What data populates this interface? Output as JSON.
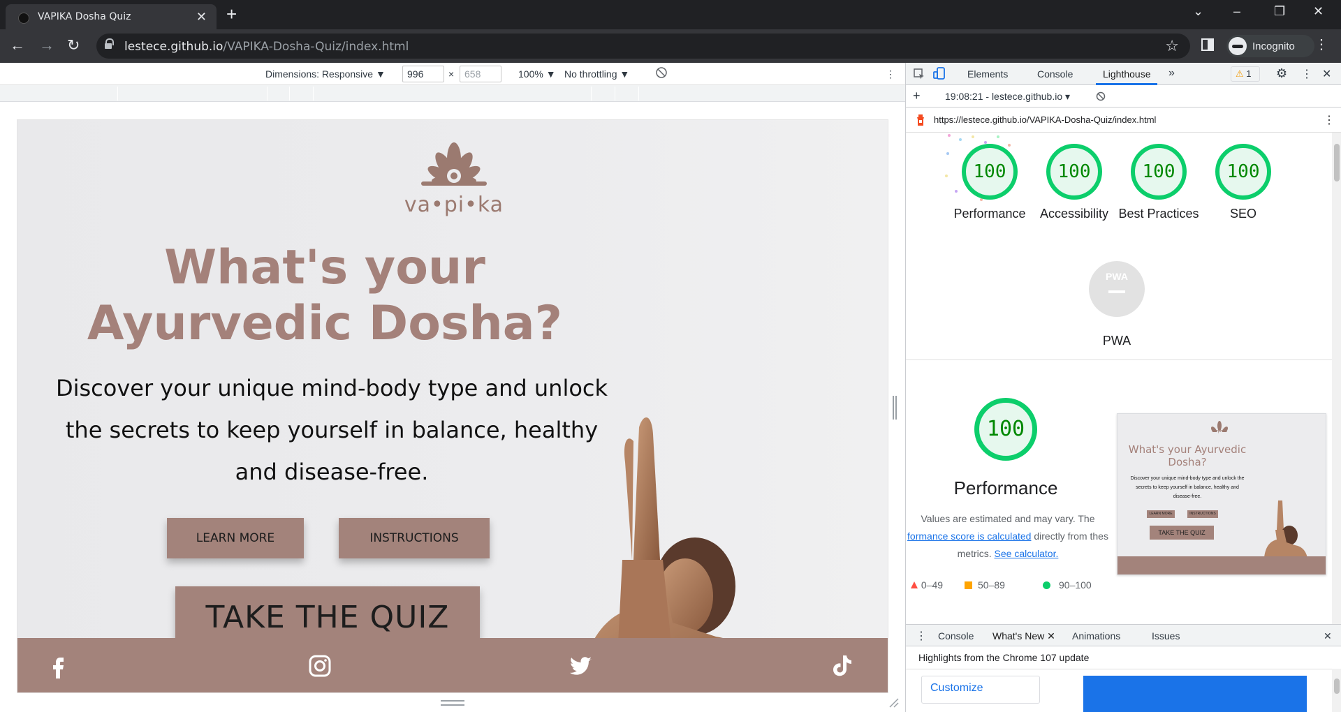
{
  "browser": {
    "tab_title": "VAPIKA Dosha Quiz",
    "tab_close": "✕",
    "new_tab": "+",
    "url_host": "lestece.github.io",
    "url_path": "/VAPIKA-Dosha-Quiz/index.html",
    "profile_label": "Incognito",
    "window_controls": {
      "dropdown": "⌄",
      "minimize": "–",
      "restore": "❐",
      "close": "✕"
    },
    "nav": {
      "back": "←",
      "forward": "→",
      "reload": "↻"
    },
    "star": "☆",
    "menu": "⋮"
  },
  "device_toolbar": {
    "dimensions_label": "Dimensions: Responsive ▼",
    "width_value": "996",
    "times": "×",
    "height_value": "658",
    "zoom_label": "100% ▼",
    "throttling_label": "No throttling ▼",
    "menu": "⋮"
  },
  "page": {
    "logo_text": "va•pi•ka",
    "headline": "What's your Ayurvedic Dosha?",
    "subheading": "Discover your unique mind-body type and unlock the secrets to keep yourself in balance, healthy and disease-free.",
    "learn_more": "LEARN MORE",
    "instructions": "INSTRUCTIONS",
    "take_quiz": "TAKE THE QUIZ",
    "brand_color": "#a3837b",
    "heading_color": "#a4817a"
  },
  "devtools": {
    "tabs": [
      "Elements",
      "Console",
      "Lighthouse"
    ],
    "active_tab": "Lighthouse",
    "more_tabs": "»",
    "warning_count": "1",
    "report_time": "19:08:21 - lestece.github.io",
    "report_url": "https://lestece.github.io/VAPIKA-Dosha-Quiz/index.html",
    "add": "+",
    "close": "✕",
    "menu": "⋮",
    "categories": [
      {
        "label": "Performance",
        "score": "100"
      },
      {
        "label": "Accessibility",
        "score": "100"
      },
      {
        "label": "Best Practices",
        "score": "100"
      },
      {
        "label": "SEO",
        "score": "100"
      }
    ],
    "pwa_label": "PWA",
    "pwa_badge": "PWA",
    "performance": {
      "score": "100",
      "title": "Performance",
      "desc_1": "Values are estimated and may vary. The",
      "desc_link_1": "formance score is calculated",
      "desc_2": " directly from thes",
      "desc_3": "metrics. ",
      "desc_link_2": "See calculator."
    },
    "legend": [
      {
        "range": "0–49",
        "color": "#ff4e42"
      },
      {
        "range": "50–89",
        "color": "#ffa400"
      },
      {
        "range": "90–100",
        "color": "#0cce6b"
      }
    ],
    "thumbnail": {
      "headline": "What's your Ayurvedic Dosha?",
      "sub": "Discover your unique mind-body type and unlock the secrets to keep yourself in balance, healthy and disease-free.",
      "learn": "LEARN MORE",
      "instr": "INSTRUCTIONS",
      "quiz": "TAKE THE QUIZ",
      "logo": "va•pi•ka"
    },
    "drawer": {
      "tabs": [
        "Console",
        "What's New",
        "Animations",
        "Issues"
      ],
      "active_tab": "What's New",
      "highlights": "Highlights from the Chrome 107 update",
      "customize": "Customize"
    },
    "score_color": "#0cce6b"
  }
}
